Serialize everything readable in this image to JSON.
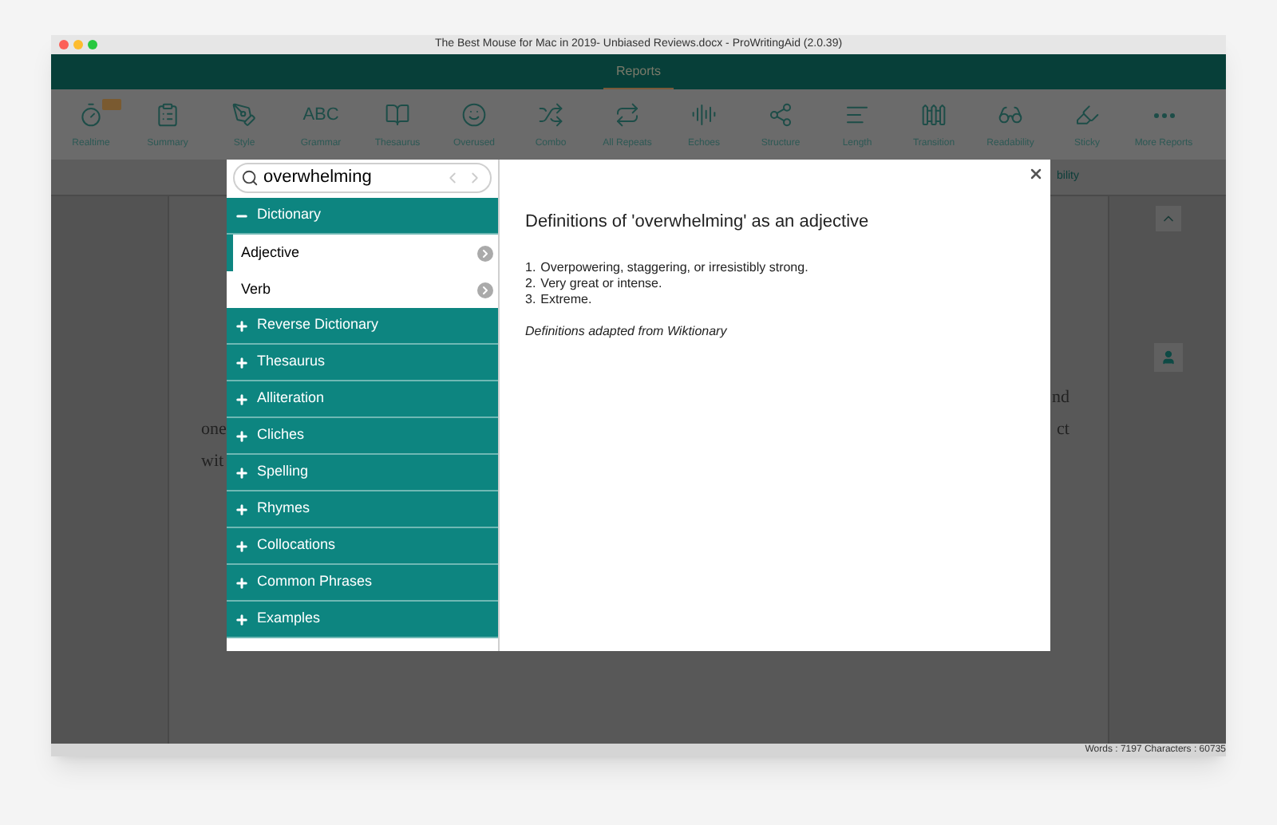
{
  "window": {
    "title": "The Best Mouse for Mac in 2019- Unbiased Reviews.docx - ProWritingAid (2.0.39)"
  },
  "header": {
    "title": "Reports"
  },
  "toolbar": [
    {
      "label": "Realtime",
      "badge": true
    },
    {
      "label": "Summary"
    },
    {
      "label": "Style"
    },
    {
      "label": "Grammar",
      "glyph": "ABC"
    },
    {
      "label": "Thesaurus"
    },
    {
      "label": "Overused"
    },
    {
      "label": "Combo"
    },
    {
      "label": "All Repeats"
    },
    {
      "label": "Echoes"
    },
    {
      "label": "Structure"
    },
    {
      "label": "Length"
    },
    {
      "label": "Transition"
    },
    {
      "label": "Readability"
    },
    {
      "label": "Sticky"
    },
    {
      "label": "More Reports"
    }
  ],
  "subbar": {
    "text": "bility"
  },
  "document": {
    "lines": [
      {
        "right": "nd"
      },
      {
        "left": "one",
        "right": "ct"
      },
      {
        "left": "wit"
      }
    ]
  },
  "status_bar": "Words : 7197 Characters : 60735",
  "dialog": {
    "search": {
      "value": "overwhelming"
    },
    "sections": [
      {
        "label": "Dictionary",
        "expanded": true,
        "children": [
          {
            "label": "Adjective",
            "selected": true
          },
          {
            "label": "Verb",
            "selected": false
          }
        ]
      },
      {
        "label": "Reverse Dictionary",
        "expanded": false
      },
      {
        "label": "Thesaurus",
        "expanded": false
      },
      {
        "label": "Alliteration",
        "expanded": false
      },
      {
        "label": "Cliches",
        "expanded": false
      },
      {
        "label": "Spelling",
        "expanded": false
      },
      {
        "label": "Rhymes",
        "expanded": false
      },
      {
        "label": "Collocations",
        "expanded": false
      },
      {
        "label": "Common Phrases",
        "expanded": false
      },
      {
        "label": "Examples",
        "expanded": false
      }
    ],
    "heading": "Definitions of 'overwhelming' as an adjective",
    "definitions": [
      {
        "number": "1.",
        "text": "Overpowering, staggering, or irresistibly strong."
      },
      {
        "number": "2.",
        "text": "Very great or intense."
      },
      {
        "number": "3.",
        "text": "Extreme."
      }
    ],
    "note": "Definitions adapted from Wiktionary"
  }
}
